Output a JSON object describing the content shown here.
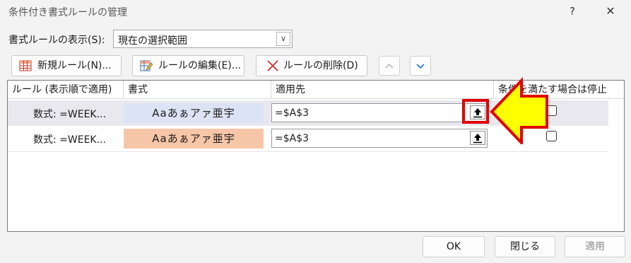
{
  "window": {
    "title": "条件付き書式ルールの管理",
    "help_glyph": "?",
    "close_glyph": "✕"
  },
  "scope": {
    "label": "書式ルールの表示(S):",
    "value": "現在の選択範囲"
  },
  "toolbar": {
    "new_rule": "新規ルール(N)...",
    "edit_rule": "ルールの編集(E)...",
    "delete_rule": "ルールの削除(D)"
  },
  "columns": {
    "rule": "ルール (表示順で適用)",
    "format": "書式",
    "applies_to": "適用先",
    "stop_if_true": "条件を満たす場合は停止"
  },
  "rules": [
    {
      "rule": "数式: =WEEK...",
      "format_sample": "Aaあぁアァ亜宇",
      "format_bg": "#dce3f5",
      "applies_to": "=$A$3",
      "stop_if_true": false,
      "selected": true
    },
    {
      "rule": "数式: =WEEK...",
      "format_sample": "Aaあぁアァ亜宇",
      "format_bg": "#f7c6a8",
      "applies_to": "=$A$3",
      "stop_if_true": false,
      "selected": false
    }
  ],
  "footer": {
    "ok": "OK",
    "close": "閉じる",
    "apply": "適用"
  },
  "colors": {
    "highlight": "#e00000",
    "arrow_fill": "#ffff00",
    "arrow_stroke": "#e00000"
  }
}
